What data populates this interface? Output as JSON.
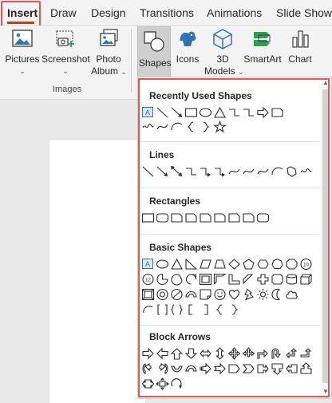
{
  "tabs": [
    {
      "label": "Insert",
      "active": true
    },
    {
      "label": "Draw"
    },
    {
      "label": "Design"
    },
    {
      "label": "Transitions"
    },
    {
      "label": "Animations"
    },
    {
      "label": "Slide Show"
    }
  ],
  "ribbon": {
    "pictures": {
      "label": "Pictures",
      "chevron": "⌄",
      "icon": "pictures-icon"
    },
    "screenshot": {
      "label": "Screenshot",
      "chevron": "⌄",
      "icon": "screenshot-icon"
    },
    "photo_album": {
      "label1": "Photo",
      "label2": "Album",
      "chevron": "⌄",
      "icon": "photo-album-icon"
    },
    "images_group_label": "Images",
    "shapes": {
      "label": "Shapes",
      "icon": "shapes-icon"
    },
    "icons": {
      "label": "Icons",
      "icon": "icons-icon"
    },
    "models_3d": {
      "label1": "3D",
      "label2": "Models",
      "chevron": "⌄",
      "icon": "cube-icon"
    },
    "smartart": {
      "label": "SmartArt",
      "icon": "smartart-icon"
    },
    "chart": {
      "label": "Chart",
      "icon": "chart-icon"
    }
  },
  "gallery": {
    "sections": [
      {
        "title": "Recently Used Shapes"
      },
      {
        "title": "Lines"
      },
      {
        "title": "Rectangles"
      },
      {
        "title": "Basic Shapes"
      },
      {
        "title": "Block Arrows"
      }
    ]
  },
  "colors": {
    "accent": "#c43e1c",
    "highlight": "#ef5350",
    "shape_stroke": "#2b2b2b",
    "shape_blue": "#2e75b6"
  }
}
